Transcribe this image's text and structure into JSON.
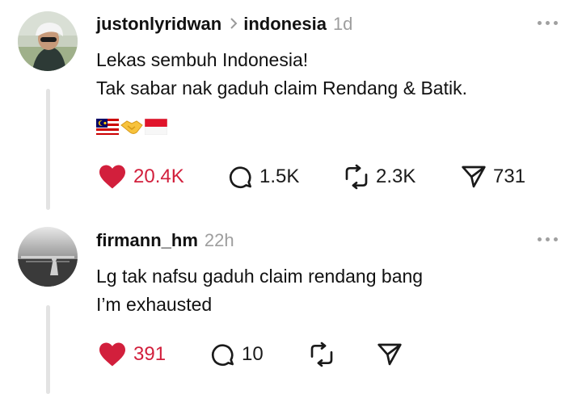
{
  "posts": [
    {
      "username": "justonlyridwan",
      "topic": "indonesia",
      "time": "1d",
      "lines": [
        "Lekas sembuh Indonesia!",
        "Tak sabar nak gaduh claim Rendang & Batik."
      ],
      "emojis": [
        "flag-malaysia",
        "handshake",
        "flag-indonesia"
      ],
      "likes": "20.4K",
      "comments": "1.5K",
      "reposts": "2.3K",
      "shares": "731",
      "liked": true
    },
    {
      "username": "firmann_hm",
      "time": "22h",
      "lines": [
        "Lg tak nafsu gaduh claim rendang bang",
        "I’m exhausted"
      ],
      "likes": "391",
      "comments": "10",
      "liked": true
    }
  ],
  "colors": {
    "like": "#d21f3c",
    "muted": "#9e9e9e",
    "thread_line": "#e3e3e3"
  }
}
